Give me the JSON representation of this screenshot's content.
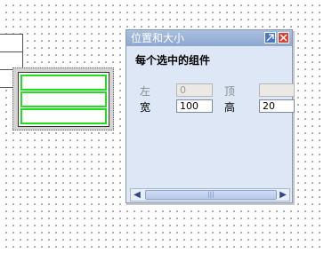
{
  "dialog": {
    "title": "位置和大小",
    "section_title": "每个选中的组件",
    "fields": {
      "left": {
        "label": "左",
        "value": "0"
      },
      "top": {
        "label": "顶",
        "value": ""
      },
      "width": {
        "label": "宽",
        "value": "100"
      },
      "height": {
        "label": "高",
        "value": "20"
      }
    }
  },
  "icons": {
    "restore": "restore-window-icon",
    "close": "close-icon",
    "scroll_left": "arrow-left-icon",
    "scroll_right": "arrow-right-icon",
    "thumb_grip": "grip-icon"
  },
  "colors": {
    "selection_outline": "#22dd22",
    "title_bar": "#8ea7cf",
    "dialog_bg": "#dde7f6"
  }
}
